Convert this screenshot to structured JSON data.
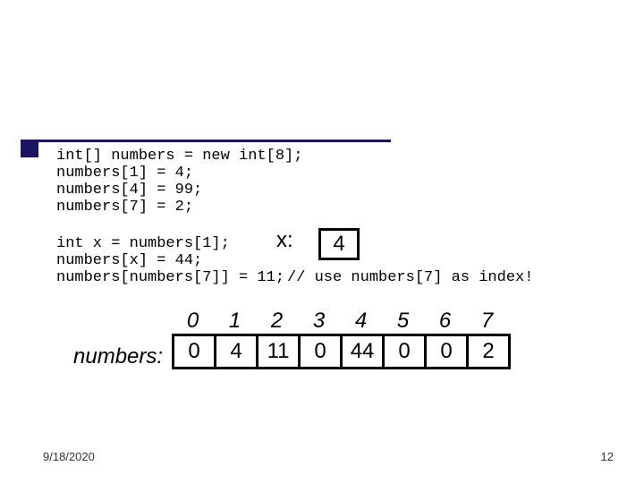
{
  "code_block1": "int[] numbers = new int[8];\nnumbers[1] = 4;\nnumbers[4] = 99;\nnumbers[7] = 2;",
  "code_block2": "int x = numbers[1];\nnumbers[x] = 44;\nnumbers[numbers[7]] = 11;",
  "comment": "// use numbers[7] as index!",
  "x_label": "x:",
  "x_value": "4",
  "array_label": "numbers:",
  "indices": [
    "0",
    "1",
    "2",
    "3",
    "4",
    "5",
    "6",
    "7"
  ],
  "cells": [
    "0",
    "4",
    "11",
    "0",
    "44",
    "0",
    "0",
    "2"
  ],
  "date": "9/18/2020",
  "pageno": "12"
}
